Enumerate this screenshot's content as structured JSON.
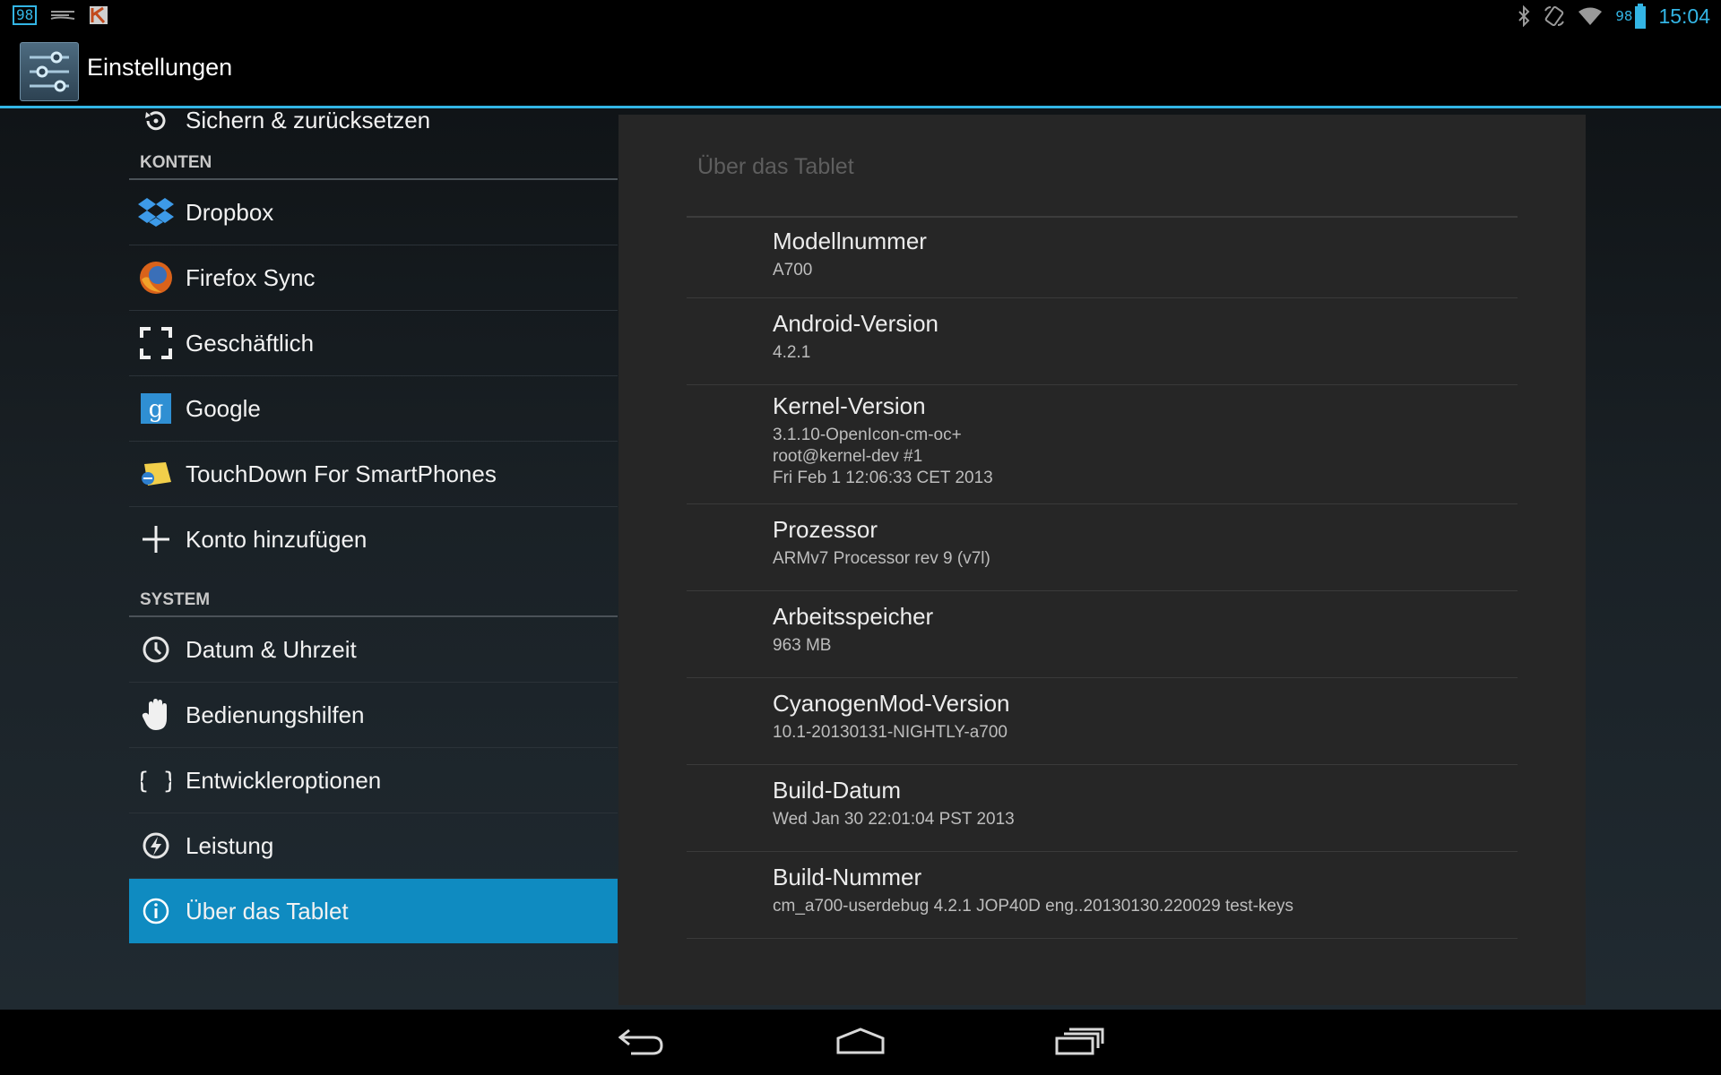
{
  "statusbar": {
    "notification_badge": "98",
    "battery_percent": "98",
    "clock": "15:04",
    "icons": [
      "notification-count-icon",
      "gesture-icon",
      "kaspersky-icon",
      "bluetooth-icon",
      "rotation-lock-icon",
      "wifi-icon",
      "battery-icon"
    ]
  },
  "actionbar": {
    "title": "Einstellungen",
    "icon": "settings-app-icon"
  },
  "sidebar": {
    "items": [
      {
        "label": "Sichern & zurücksetzen",
        "icon": "backup-restore-icon"
      },
      {
        "label": "Dropbox",
        "icon": "dropbox-icon"
      },
      {
        "label": "Firefox Sync",
        "icon": "firefox-icon"
      },
      {
        "label": "Geschäftlich",
        "icon": "corporate-account-icon"
      },
      {
        "label": "Google",
        "icon": "google-icon"
      },
      {
        "label": "TouchDown For SmartPhones",
        "icon": "touchdown-icon"
      },
      {
        "label": "Konto hinzufügen",
        "icon": "add-icon"
      },
      {
        "label": "Datum & Uhrzeit",
        "icon": "clock-icon"
      },
      {
        "label": "Bedienungshilfen",
        "icon": "accessibility-hand-icon"
      },
      {
        "label": "Entwickleroptionen",
        "icon": "braces-icon"
      },
      {
        "label": "Leistung",
        "icon": "performance-icon"
      },
      {
        "label": "Über das Tablet",
        "icon": "info-icon",
        "selected": true
      }
    ],
    "sections": {
      "accounts": "KONTEN",
      "system": "SYSTEM"
    }
  },
  "detail": {
    "title": "Über das Tablet",
    "rows": [
      {
        "title": "Modellnummer",
        "value": "A700"
      },
      {
        "title": "Android-Version",
        "value": "4.2.1"
      },
      {
        "title": "Kernel-Version",
        "value": "3.1.10-OpenIcon-cm-oc+\nroot@kernel-dev #1\nFri Feb 1 12:06:33 CET 2013"
      },
      {
        "title": "Prozessor",
        "value": "ARMv7 Processor rev 9 (v7l)"
      },
      {
        "title": "Arbeitsspeicher",
        "value": "963 MB"
      },
      {
        "title": "CyanogenMod-Version",
        "value": "10.1-20130131-NIGHTLY-a700"
      },
      {
        "title": "Build-Datum",
        "value": "Wed Jan 30 22:01:04 PST 2013"
      },
      {
        "title": "Build-Nummer",
        "value": "cm_a700-userdebug 4.2.1 JOP40D eng..20130130.220029 test-keys"
      }
    ]
  },
  "navbar": {
    "buttons": [
      "back-icon",
      "home-icon",
      "recent-apps-icon"
    ]
  },
  "colors": {
    "accent": "#33b5e5",
    "selected_item": "#0f8bc1",
    "detail_pane": "#262626"
  }
}
